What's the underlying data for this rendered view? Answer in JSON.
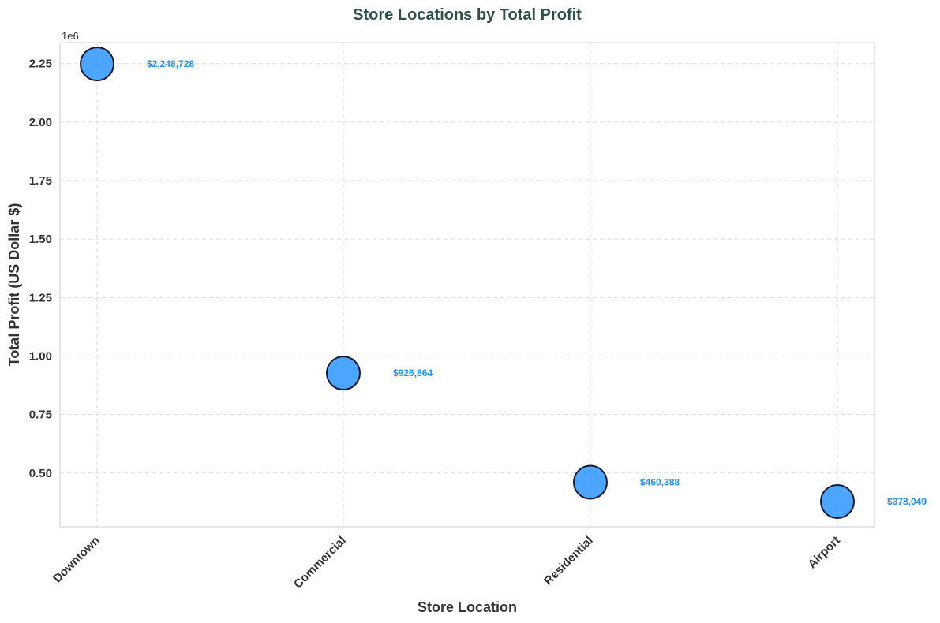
{
  "chart_data": {
    "type": "scatter",
    "title": "Store Locations by Total Profit",
    "xlabel": "Store Location",
    "ylabel": "Total Profit (US Dollar $)",
    "y_offset_label": "1e6",
    "categories": [
      "Downtown",
      "Commercial",
      "Residential",
      "Airport"
    ],
    "values": [
      2248728,
      926864,
      460388,
      378049
    ],
    "data_labels": [
      "$2,248,728",
      "$926,864",
      "$460,388",
      "$378,049"
    ],
    "ylim": [
      270000,
      2340000
    ],
    "yticks": [
      500000,
      750000,
      1000000,
      1250000,
      1500000,
      1750000,
      2000000,
      2250000
    ],
    "ytick_labels": [
      "0.50",
      "0.75",
      "1.00",
      "1.25",
      "1.50",
      "1.75",
      "2.00",
      "2.25"
    ],
    "grid": true,
    "colors": {
      "marker_fill": "#3399ff",
      "marker_edge": "#1a1a2e",
      "data_label": "#1e90ff",
      "title": "#2f4f4f"
    }
  }
}
